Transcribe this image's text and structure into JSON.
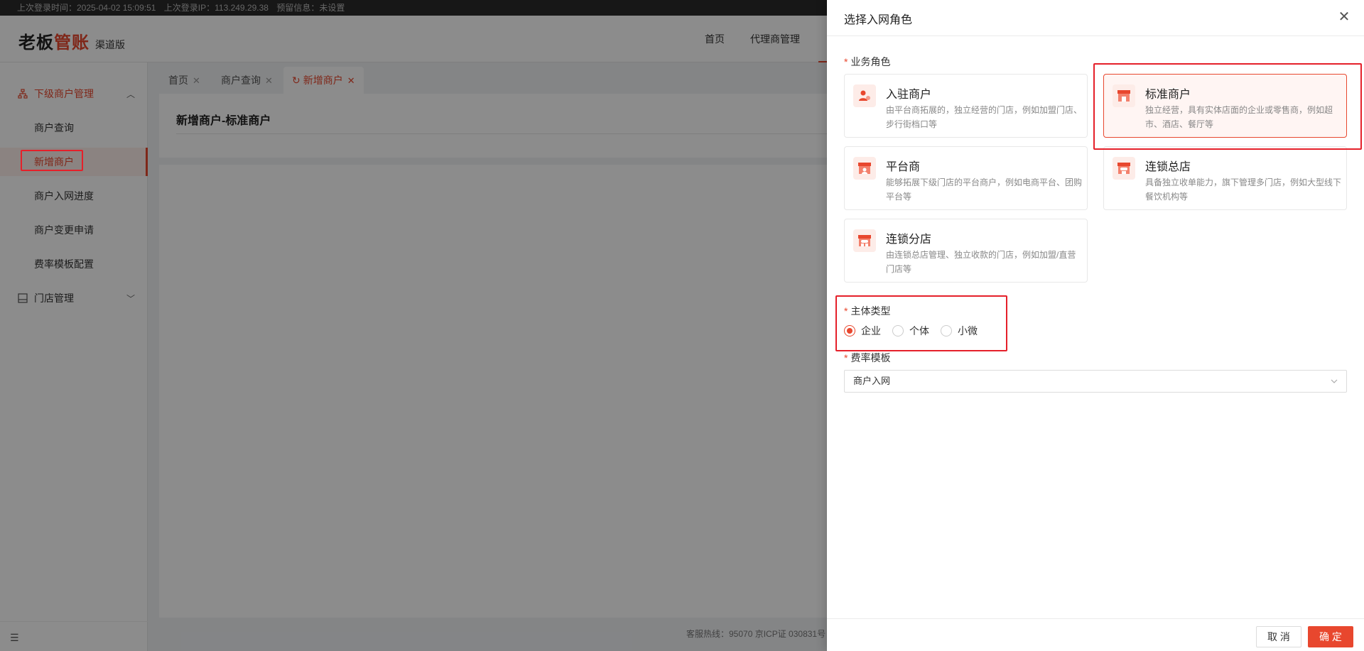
{
  "topbar": {
    "login_time": "上次登录时间：2025-04-02 15:09:51",
    "login_ip": "上次登录IP：113.249.29.38",
    "warning": "预留信息：未设置"
  },
  "header": {
    "logo_part1": "老板",
    "logo_part2": "管账",
    "logo_sub": "渠道版",
    "nav": [
      "首页",
      "代理商管理"
    ]
  },
  "sidebar": {
    "group1": "下级商户管理",
    "items": [
      "商户查询",
      "新增商户",
      "商户入网进度",
      "商户变更申请",
      "费率模板配置"
    ],
    "group2": "门店管理"
  },
  "tabs": [
    {
      "label": "首页"
    },
    {
      "label": "商户查询"
    },
    {
      "label": "新增商户"
    }
  ],
  "content": {
    "title": "新增商户-标准商户"
  },
  "footer": {
    "text": "客服热线：95070 京ICP证 030831号"
  },
  "drawer": {
    "title": "选择入网角色",
    "role_label": "业务角色",
    "roles": [
      {
        "title": "入驻商户",
        "desc": "由平台商拓展的，独立经营的门店，例如加盟门店、步行街档口等"
      },
      {
        "title": "标准商户",
        "desc": "独立经营，具有实体店面的企业或零售商，例如超市、酒店、餐厅等"
      },
      {
        "title": "平台商",
        "desc": "能够拓展下级门店的平台商户，例如电商平台、团购平台等"
      },
      {
        "title": "连锁总店",
        "desc": "具备独立收单能力，旗下管理多门店，例如大型线下餐饮机构等"
      },
      {
        "title": "连锁分店",
        "desc": "由连锁总店管理、独立收款的门店，例如加盟/直营门店等"
      }
    ],
    "entity_label": "主体类型",
    "entity_options": [
      "企业",
      "个体",
      "小微"
    ],
    "entity_selected": "企业",
    "template_label": "费率模板",
    "template_value": "商户入网",
    "cancel_label": "取 消",
    "confirm_label": "确 定"
  },
  "colors": {
    "accent": "#e8472e",
    "highlight": "#e5202a"
  }
}
